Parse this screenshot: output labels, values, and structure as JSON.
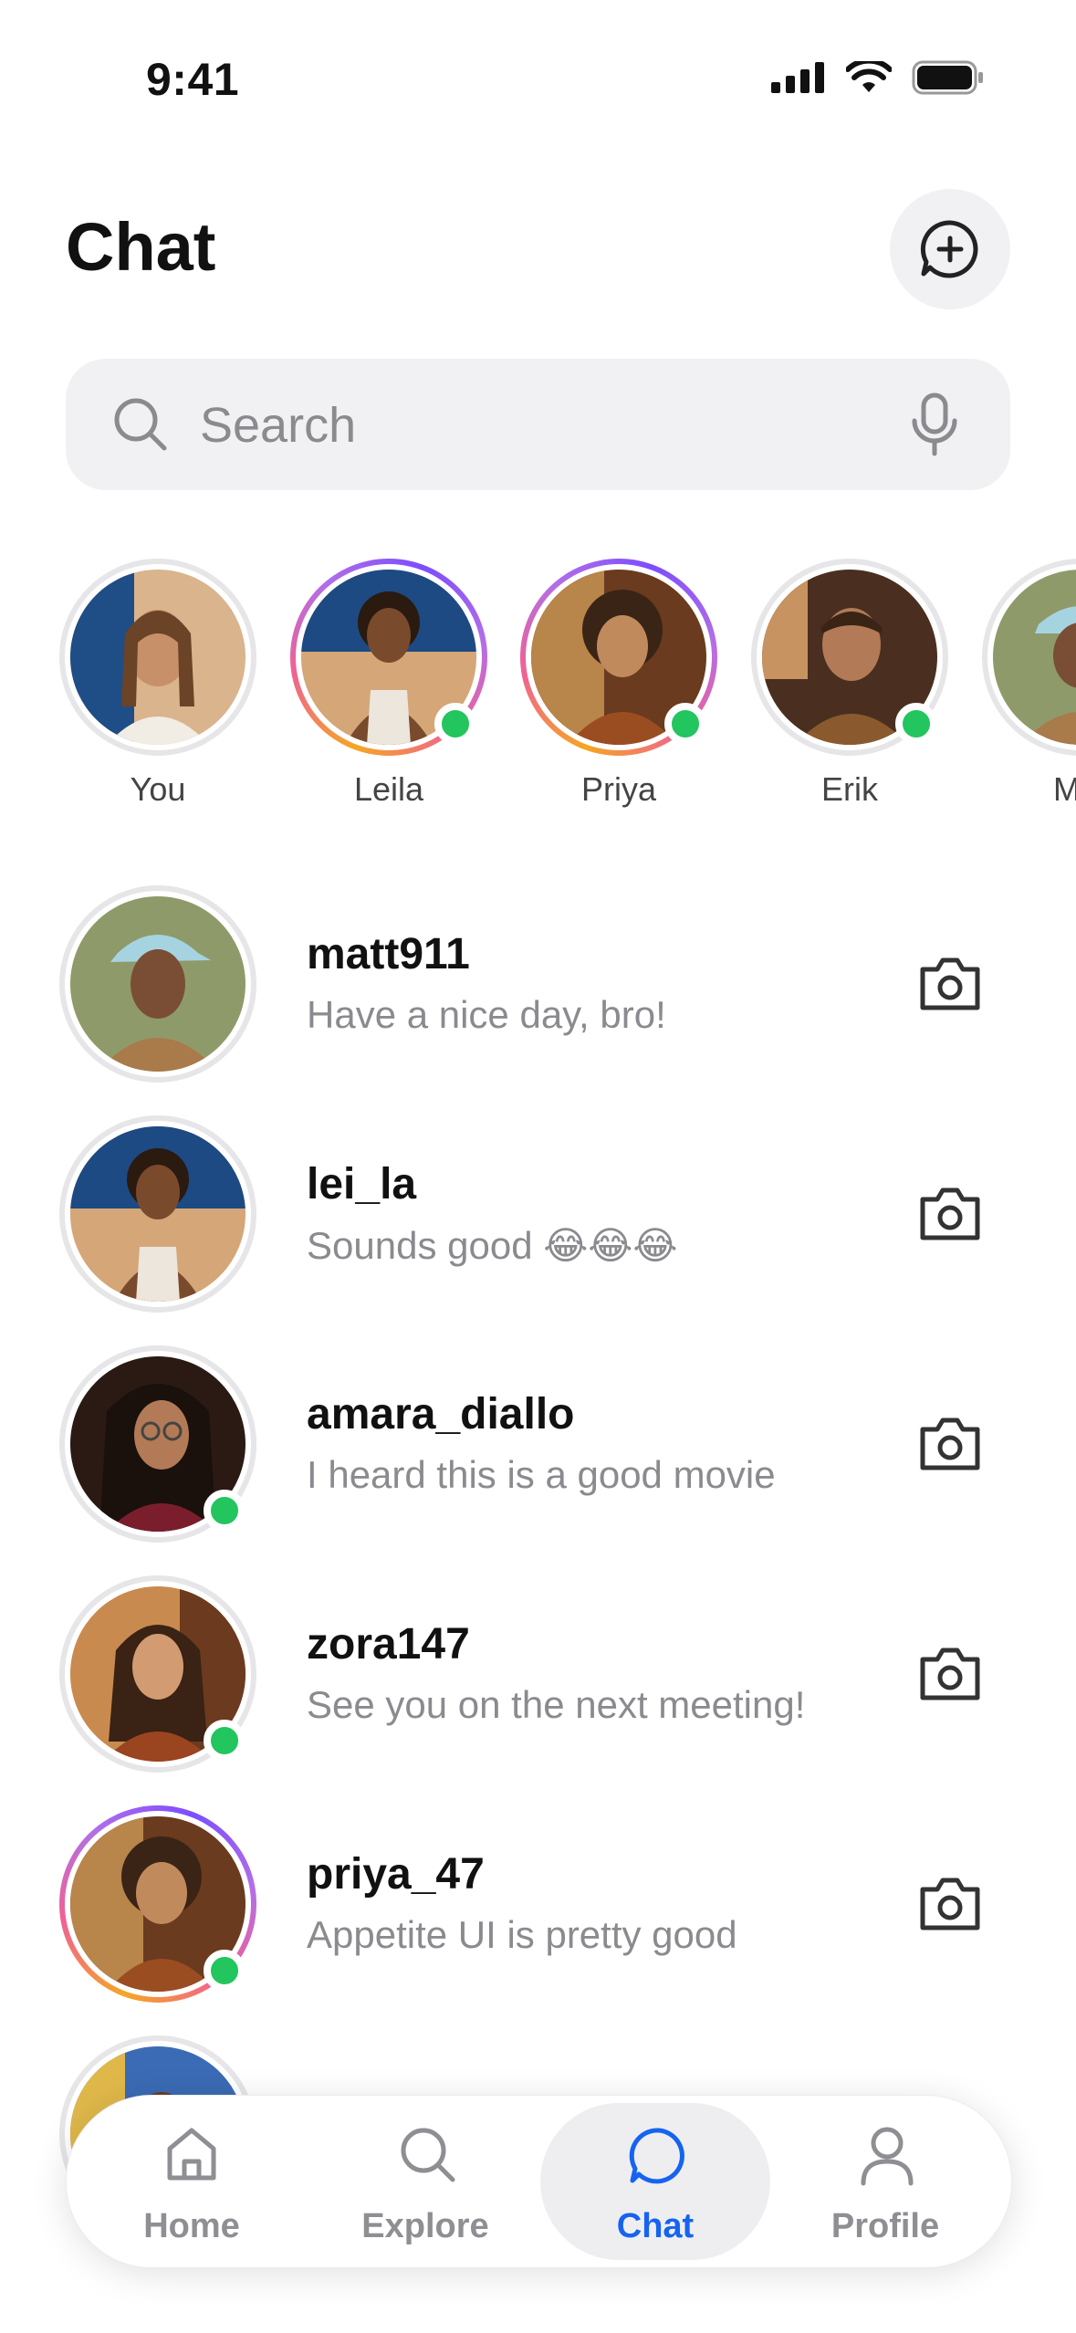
{
  "status_bar": {
    "time": "9:41"
  },
  "header": {
    "title": "Chat"
  },
  "search": {
    "placeholder": "Search"
  },
  "stories": [
    {
      "name": "You",
      "ring": "seen",
      "online": false
    },
    {
      "name": "Leila",
      "ring": "new",
      "online": true
    },
    {
      "name": "Priya",
      "ring": "new",
      "online": true
    },
    {
      "name": "Erik",
      "ring": "seen",
      "online": true
    },
    {
      "name": "Mat",
      "ring": "seen",
      "online": false
    }
  ],
  "chats": [
    {
      "username": "matt911",
      "message": "Have a nice day, bro!",
      "online": false,
      "ring": "seen"
    },
    {
      "username": "lei_la",
      "message": "Sounds good 😂😂😂",
      "online": false,
      "ring": "seen"
    },
    {
      "username": "amara_diallo",
      "message": "I heard this is a good movie",
      "online": true,
      "ring": "seen"
    },
    {
      "username": "zora147",
      "message": "See you on the next meeting!",
      "online": true,
      "ring": "seen"
    },
    {
      "username": "priya_47",
      "message": "Appetite UI is pretty good",
      "online": true,
      "ring": "new"
    }
  ],
  "tabs": [
    {
      "label": "Home",
      "icon": "home-icon",
      "active": false
    },
    {
      "label": "Explore",
      "icon": "search-icon",
      "active": false
    },
    {
      "label": "Chat",
      "icon": "chat-icon",
      "active": true
    },
    {
      "label": "Profile",
      "icon": "profile-icon",
      "active": false
    }
  ],
  "colors": {
    "accent": "#1663f0",
    "online": "#22c55e",
    "muted": "#8a8a8f",
    "surface": "#f1f1f3"
  }
}
